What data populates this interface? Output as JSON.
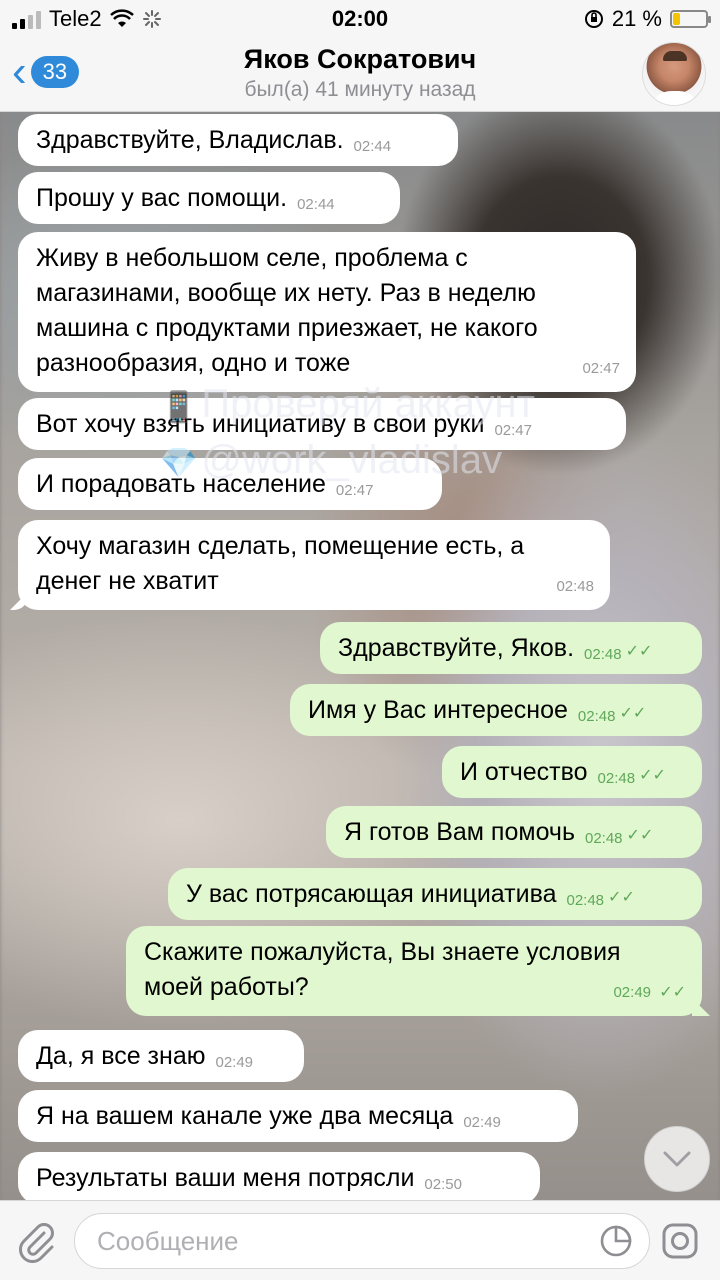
{
  "status_bar": {
    "carrier": "Tele2",
    "time": "02:00",
    "battery_percent": "21 %",
    "battery_level": 0.21,
    "icons": [
      "signal-icon",
      "wifi-icon",
      "activity-icon",
      "orientation-lock-icon",
      "battery-icon"
    ]
  },
  "header": {
    "back_count": "33",
    "title": "Яков Сократович",
    "subtitle": "был(а) 41 минуту назад"
  },
  "messages": [
    {
      "dir": "in",
      "text": "Здравствуйте, Владислав.",
      "time": "02:44"
    },
    {
      "dir": "in",
      "text": "Прошу у вас помощи.",
      "time": "02:44"
    },
    {
      "dir": "in",
      "text": "Живу в небольшом селе, проблема с магазинами, вообще их нету. Раз в неделю машина с продуктами приезжает, не какого разнообразия, одно и тоже",
      "time": "02:47"
    },
    {
      "dir": "in",
      "text": "Вот хочу взять инициативу в свои руки",
      "time": "02:47"
    },
    {
      "dir": "in",
      "text": "И порадовать население",
      "time": "02:47"
    },
    {
      "dir": "in",
      "text": "Хочу магазин сделать, помещение есть, а денег не хватит",
      "time": "02:48"
    },
    {
      "dir": "out",
      "text": "Здравствуйте, Яков.",
      "time": "02:48"
    },
    {
      "dir": "out",
      "text": "Имя у Вас интересное",
      "time": "02:48"
    },
    {
      "dir": "out",
      "text": "И отчество",
      "time": "02:48"
    },
    {
      "dir": "out",
      "text": "Я готов Вам помочь",
      "time": "02:48"
    },
    {
      "dir": "out",
      "text": "У вас потрясающая инициатива",
      "time": "02:48"
    },
    {
      "dir": "out",
      "text": "Скажите пожалуйста, Вы знаете условия моей работы?",
      "time": "02:49"
    },
    {
      "dir": "in",
      "text": "Да, я все знаю",
      "time": "02:49"
    },
    {
      "dir": "in",
      "text": "Я на вашем канале уже два месяца",
      "time": "02:49"
    },
    {
      "dir": "in",
      "text": "Результаты ваши меня потрясли",
      "time": "02:50"
    }
  ],
  "watermark": {
    "line1": "Проверяй аккаунт",
    "line2": "@work_vladislav"
  },
  "input": {
    "placeholder": "Сообщение"
  }
}
